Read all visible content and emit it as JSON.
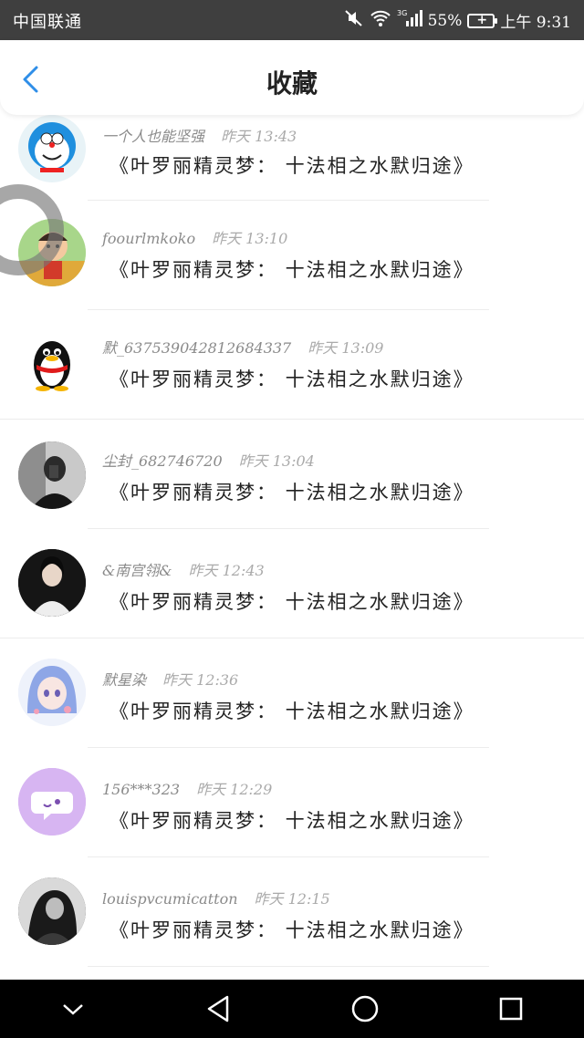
{
  "status_bar": {
    "carrier": "中国联通",
    "network": "3G",
    "battery": "55%",
    "time": "上午 9:31"
  },
  "header": {
    "title": "收藏"
  },
  "favorites": [
    {
      "user": "一个人也能坚强",
      "time": "昨天 13:43",
      "message": "《叶罗丽精灵梦： 十法相之水默归途》",
      "avatar": "doraemon"
    },
    {
      "user": "foourlmkoko",
      "time": "昨天 13:10",
      "message": "《叶罗丽精灵梦： 十法相之水默归途》",
      "avatar": "cartoon-boy"
    },
    {
      "user": "默_637539042812684337",
      "time": "昨天 13:09",
      "message": "《叶罗丽精灵梦： 十法相之水默归途》",
      "avatar": "qq-penguin"
    },
    {
      "user": "尘封_682746720",
      "time": "昨天 13:04",
      "message": "《叶罗丽精灵梦： 十法相之水默归途》",
      "avatar": "photo-dark"
    },
    {
      "user": "&南宫翎&",
      "time": "昨天 12:43",
      "message": "《叶罗丽精灵梦： 十法相之水默归途》",
      "avatar": "photo-woman"
    },
    {
      "user": "默星染",
      "time": "昨天 12:36",
      "message": "《叶罗丽精灵梦： 十法相之水默归途》",
      "avatar": "anime-girl"
    },
    {
      "user": "156***323",
      "time": "昨天 12:29",
      "message": "《叶罗丽精灵梦： 十法相之水默归途》",
      "avatar": "chat-bubble"
    },
    {
      "user": "louispvcumicatton",
      "time": "昨天 12:15",
      "message": "《叶罗丽精灵梦： 十法相之水默归途》",
      "avatar": "photo-bw"
    }
  ],
  "colors": {
    "accent": "#2f8ee8",
    "status_bar": "#3f3f3f",
    "nav_bar": "#000000"
  }
}
